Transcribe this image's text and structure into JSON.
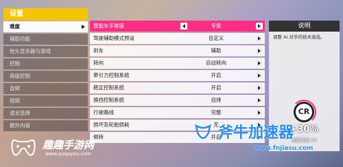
{
  "menu": {
    "title": "设置",
    "items": [
      {
        "label": "难度",
        "active": true
      },
      {
        "label": "辅助功能"
      },
      {
        "label": "抬头显示器与游戏"
      },
      {
        "label": "控制"
      },
      {
        "label": "高级控制"
      },
      {
        "label": "音频"
      },
      {
        "label": "视频"
      },
      {
        "label": "语言选择"
      },
      {
        "label": "额外内容"
      }
    ]
  },
  "settings": [
    {
      "label": "智能车手难度",
      "value": "专家"
    },
    {
      "label": "驾驶辅助模式预设",
      "value": "自定义"
    },
    {
      "label": "刹车",
      "value": "辅助"
    },
    {
      "label": "转向",
      "value": "自动转向"
    },
    {
      "label": "牵引力控制系统",
      "value": "开启"
    },
    {
      "label": "稳定控制系统",
      "value": "开启"
    },
    {
      "label": "换挡控制系统",
      "value": "自排"
    },
    {
      "label": "行驶路线",
      "value": "完整"
    },
    {
      "label": "损坏及轮胎损耗",
      "value": "无"
    },
    {
      "label": "倒转",
      "value": "开启"
    }
  ],
  "description": {
    "title": "说明",
    "text": "调整 AI 对手的技术高低。",
    "badge": "CR",
    "bonus": "+30%",
    "bonus_label": "难度奖励 CR"
  },
  "watermarks": {
    "left_brand": "趣趣手游网",
    "left_url": "www.ququyou.com",
    "right_brand": "斧牛加速器",
    "right_url": "www.fnjiasu.com"
  },
  "colors": {
    "accent_yellow": "#f5c400",
    "selected_pink": "#ff2d86",
    "watermark_blue": "#2a8ff0"
  }
}
